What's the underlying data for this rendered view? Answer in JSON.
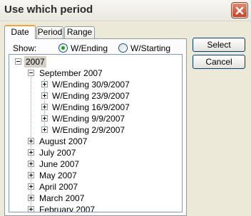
{
  "window": {
    "title": "Use which period"
  },
  "tabs": [
    {
      "label": "Date"
    },
    {
      "label": "Period"
    },
    {
      "label": "Range"
    }
  ],
  "show": {
    "label": "Show:",
    "options": [
      {
        "label": "W/Ending",
        "selected": true
      },
      {
        "label": "W/Starting",
        "selected": false
      }
    ]
  },
  "tree": {
    "year": "2007",
    "expanded_month": "September 2007",
    "weeks": [
      "W/Ending 30/9/2007",
      "W/Ending 23/9/2007",
      "W/Ending 16/9/2007",
      "W/Ending 9/9/2007",
      "W/Ending 2/9/2007"
    ],
    "months": [
      "August 2007",
      "July 2007",
      "June 2007",
      "May 2007",
      "April 2007",
      "March 2007",
      "February 2007"
    ]
  },
  "buttons": {
    "select": "Select",
    "cancel": "Cancel"
  }
}
